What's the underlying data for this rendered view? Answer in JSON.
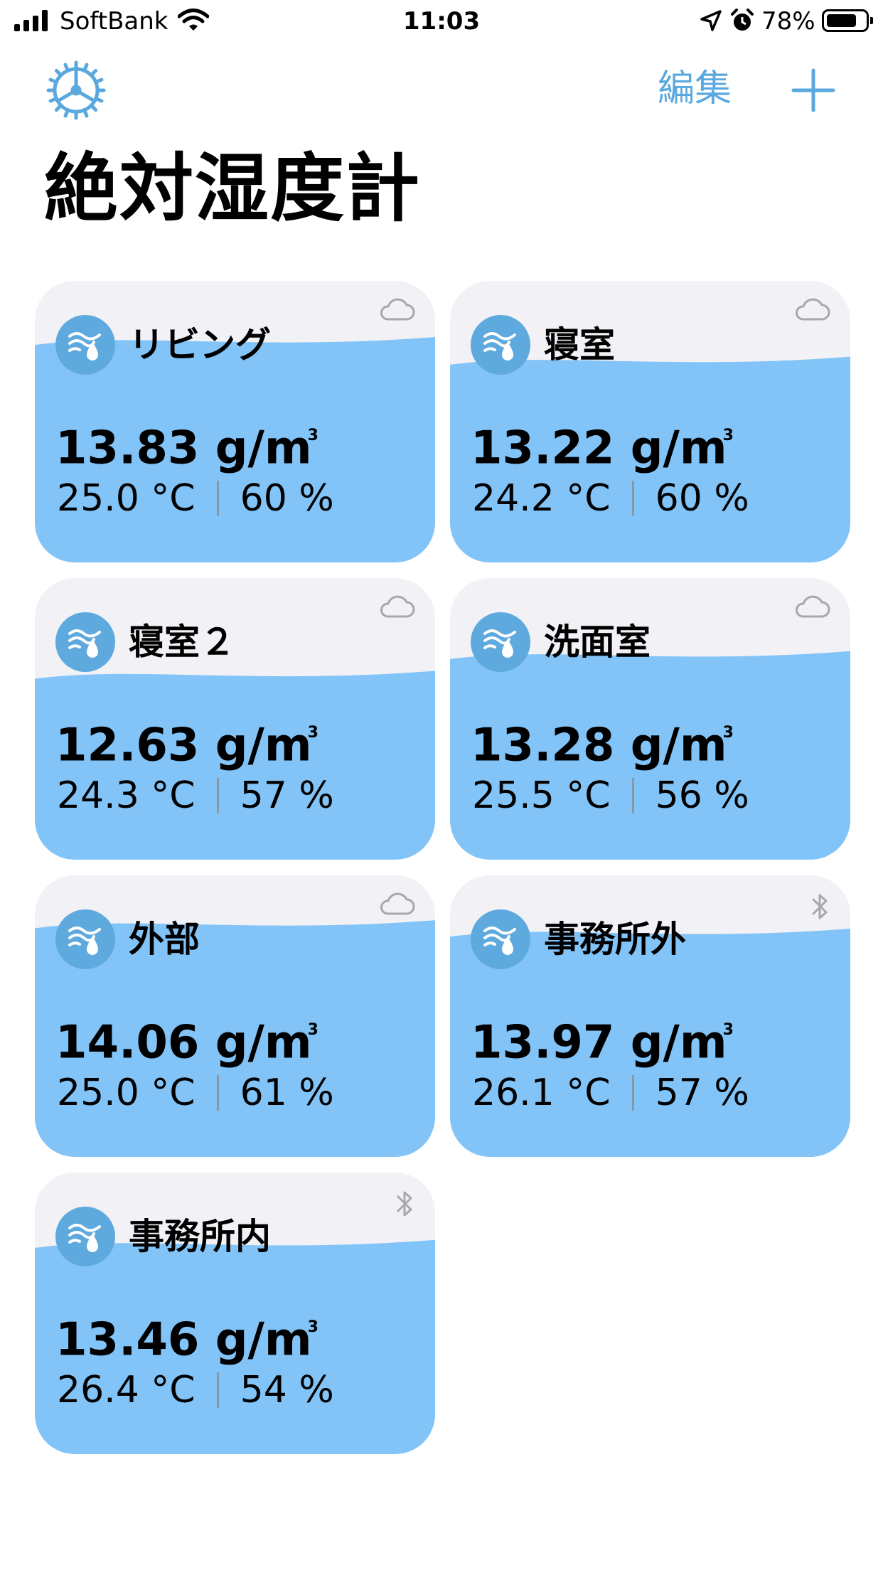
{
  "status_bar": {
    "carrier": "SoftBank",
    "time": "11:03",
    "battery": "78%",
    "battery_level": 0.78
  },
  "nav": {
    "settings_icon": "gear-icon",
    "edit_label": "編集",
    "add_icon": "plus-icon"
  },
  "title": "絶対湿度計",
  "colors": {
    "accent": "#5aa8dd",
    "water": "#82c4f8",
    "card_bg": "#f1f1f6",
    "badge": "#5ea9de"
  },
  "sensors": [
    {
      "name": "リビング",
      "absolute_humidity": "13.83 g/m",
      "unit_sup": "3",
      "temperature": "25.0 °C",
      "humidity": "60 %",
      "source_icon": "cloud-icon",
      "level": 0.79
    },
    {
      "name": "寝室",
      "absolute_humidity": "13.22 g/m",
      "unit_sup": "3",
      "temperature": "24.2 °C",
      "humidity": "60 %",
      "source_icon": "cloud-icon",
      "level": 0.72
    },
    {
      "name": "寝室２",
      "absolute_humidity": "12.63 g/m",
      "unit_sup": "3",
      "temperature": "24.3 °C",
      "humidity": "57 %",
      "source_icon": "cloud-icon",
      "level": 0.66
    },
    {
      "name": "洗面室",
      "absolute_humidity": "13.28 g/m",
      "unit_sup": "3",
      "temperature": "25.5 °C",
      "humidity": "56 %",
      "source_icon": "cloud-icon",
      "level": 0.73
    },
    {
      "name": "外部",
      "absolute_humidity": "14.06 g/m",
      "unit_sup": "3",
      "temperature": "25.0 °C",
      "humidity": "61 %",
      "source_icon": "cloud-icon",
      "level": 0.83
    },
    {
      "name": "事務所外",
      "absolute_humidity": "13.97 g/m",
      "unit_sup": "3",
      "temperature": "26.1 °C",
      "humidity": "57 %",
      "source_icon": "bluetooth-icon",
      "level": 0.8
    },
    {
      "name": "事務所内",
      "absolute_humidity": "13.46 g/m",
      "unit_sup": "3",
      "temperature": "26.4 °C",
      "humidity": "54 %",
      "source_icon": "bluetooth-icon",
      "level": 0.75
    }
  ]
}
